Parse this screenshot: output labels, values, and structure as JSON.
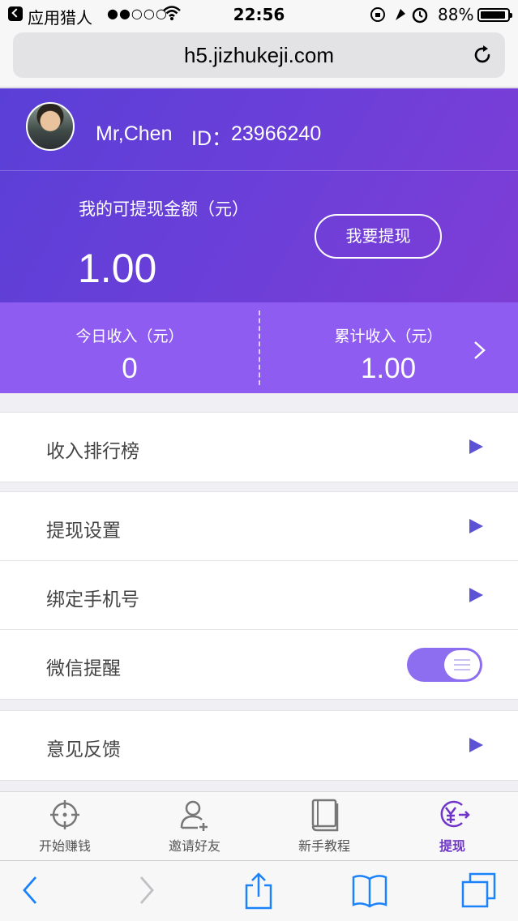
{
  "status_bar": {
    "back_app": "应用猎人",
    "signal": "●●○○○",
    "time": "22:56",
    "battery": "88%"
  },
  "browser": {
    "url": "h5.jizhukeji.com"
  },
  "user": {
    "name": "Mr,Chen",
    "id_label": "ID：",
    "id": "23966240"
  },
  "balance": {
    "label": "我的可提现金额（元）",
    "value": "1.00",
    "withdraw_button": "我要提现"
  },
  "stats": {
    "today_label": "今日收入（元）",
    "today_value": "0",
    "total_label": "累计收入（元）",
    "total_value": "1.00"
  },
  "menu": {
    "ranking": "收入排行榜",
    "withdraw_settings": "提现设置",
    "bind_phone": "绑定手机号",
    "wechat_reminder": "微信提醒",
    "wechat_reminder_on": true,
    "feedback": "意见反馈"
  },
  "tabs": [
    {
      "label": "开始赚钱",
      "icon": "crosshair-icon"
    },
    {
      "label": "邀请好友",
      "icon": "add-user-icon"
    },
    {
      "label": "新手教程",
      "icon": "book-icon"
    },
    {
      "label": "提现",
      "icon": "yuan-withdraw-icon",
      "active": true
    }
  ],
  "colors": {
    "header_gradient_start": "#5a3fd6",
    "header_gradient_end": "#7e3ed6",
    "stats_bg": "#8e5cf0",
    "arrow": "#5c52d6",
    "active_tab": "#6f35c8",
    "safari_blue": "#1a82fb"
  }
}
